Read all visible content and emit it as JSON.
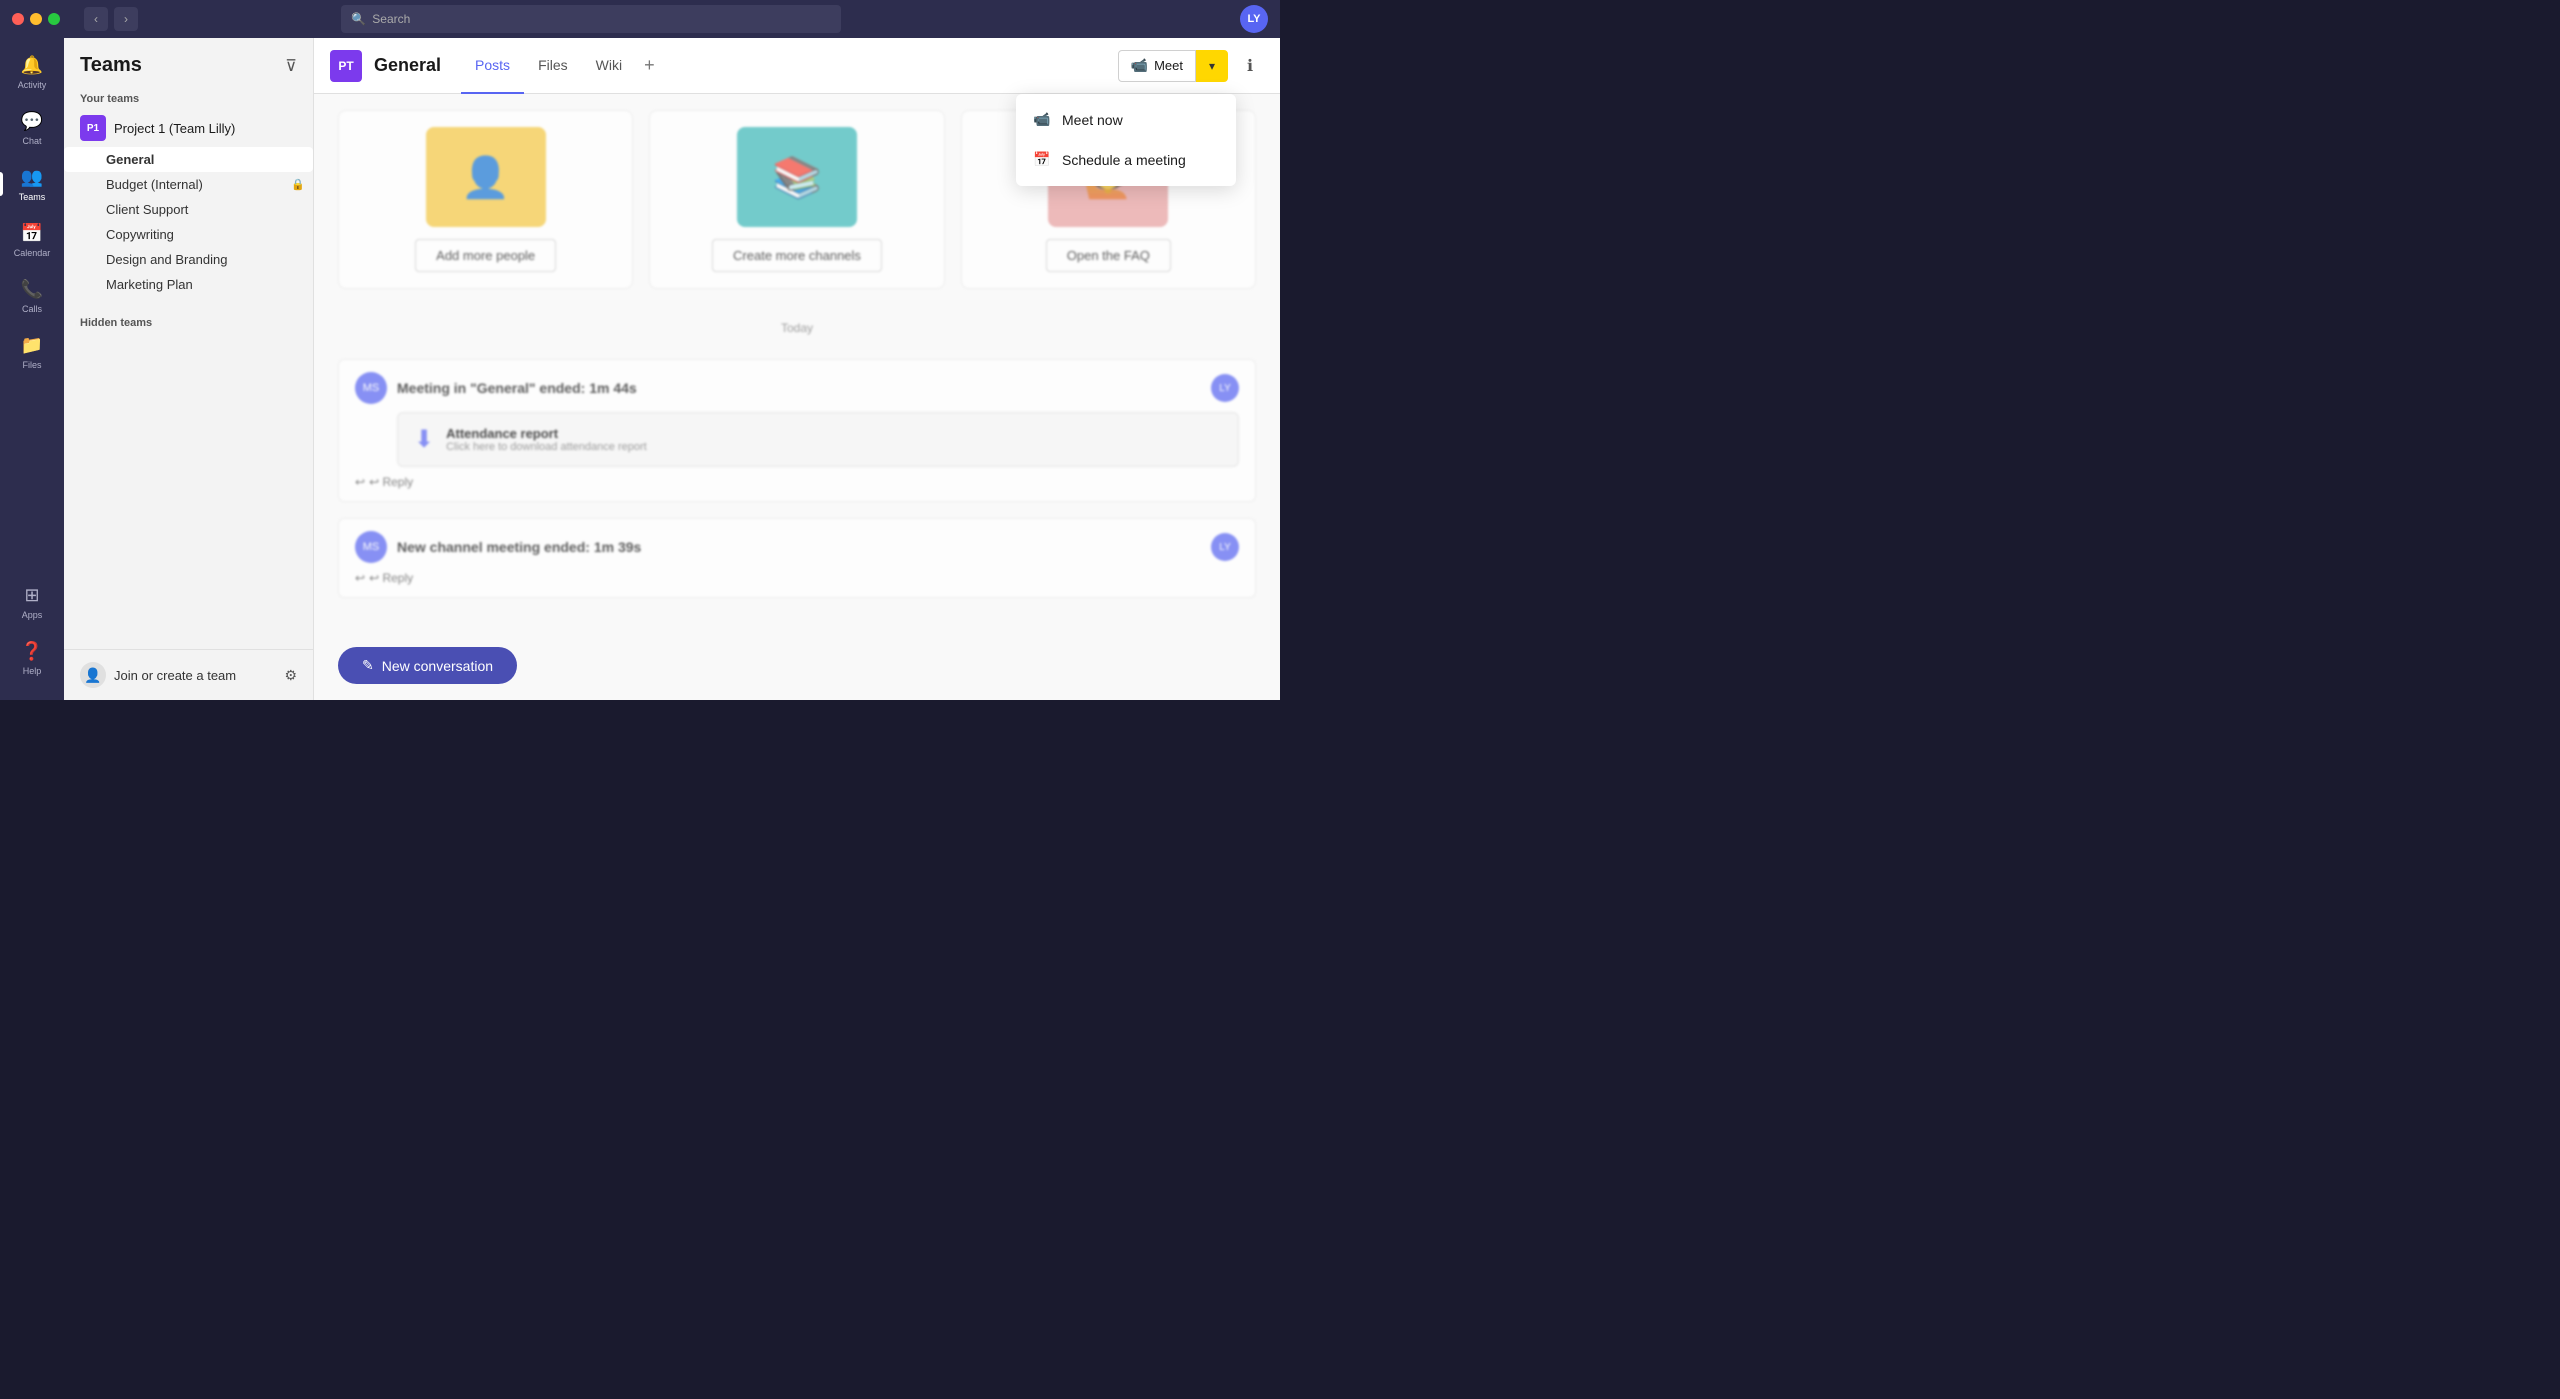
{
  "titlebar": {
    "search_placeholder": "Search",
    "user_initials": "LY"
  },
  "sidebar": {
    "title": "Teams",
    "your_teams_label": "Your teams",
    "hidden_teams_label": "Hidden teams",
    "join_team_label": "Join or create a team",
    "teams": [
      {
        "id": "team1",
        "name": "Project 1 (Team Lilly)",
        "avatar_initials": "P1",
        "channels": [
          {
            "id": "general",
            "name": "General",
            "active": true
          },
          {
            "id": "budget",
            "name": "Budget (Internal)",
            "active": false,
            "has_icon": true
          },
          {
            "id": "client-support",
            "name": "Client Support",
            "active": false
          },
          {
            "id": "copywriting",
            "name": "Copywriting",
            "active": false
          },
          {
            "id": "design",
            "name": "Design and Branding",
            "active": false
          },
          {
            "id": "marketing",
            "name": "Marketing Plan",
            "active": false
          }
        ]
      }
    ]
  },
  "nav": {
    "items": [
      {
        "id": "activity",
        "label": "Activity",
        "icon": "🔔"
      },
      {
        "id": "chat",
        "label": "Chat",
        "icon": "💬"
      },
      {
        "id": "teams",
        "label": "Teams",
        "icon": "👥",
        "active": true
      },
      {
        "id": "calendar",
        "label": "Calendar",
        "icon": "📅"
      },
      {
        "id": "calls",
        "label": "Calls",
        "icon": "📞"
      },
      {
        "id": "files",
        "label": "Files",
        "icon": "📁"
      }
    ],
    "bottom_items": [
      {
        "id": "apps",
        "label": "Apps",
        "icon": "⊞"
      },
      {
        "id": "help",
        "label": "Help",
        "icon": "?"
      }
    ]
  },
  "channel": {
    "name": "General",
    "avatar_initials": "PT",
    "tabs": [
      {
        "id": "posts",
        "label": "Posts",
        "active": true
      },
      {
        "id": "files",
        "label": "Files",
        "active": false
      },
      {
        "id": "wiki",
        "label": "Wiki",
        "active": false
      }
    ]
  },
  "header_actions": {
    "meet_label": "Meet",
    "dropdown_arrow": "▾",
    "info_icon": "ℹ"
  },
  "dropdown_menu": {
    "visible": true,
    "items": [
      {
        "id": "meet-now",
        "label": "Meet now",
        "icon": "📷"
      },
      {
        "id": "schedule",
        "label": "Schedule a meeting",
        "icon": "📅"
      }
    ]
  },
  "content": {
    "date_divider": "Today",
    "cards": [
      {
        "id": "add-people",
        "btn_label": "Add more people",
        "color": "yellow"
      },
      {
        "id": "create-channels",
        "btn_label": "Create more channels",
        "color": "teal"
      },
      {
        "id": "open-faq",
        "btn_label": "Open the FAQ",
        "color": "pink"
      }
    ],
    "messages": [
      {
        "id": "msg1",
        "text": "Meeting in \"General\" ended: 1m 44s",
        "has_attachment": true,
        "attachment_title": "Attendance report",
        "attachment_sub": "Click here to download attendance report",
        "reply_label": "↩ Reply"
      },
      {
        "id": "msg2",
        "text": "New channel meeting ended: 1m 39s",
        "has_attachment": false,
        "reply_label": "↩ Reply"
      }
    ],
    "new_conversation_label": "New conversation",
    "new_conversation_icon": "✎"
  }
}
